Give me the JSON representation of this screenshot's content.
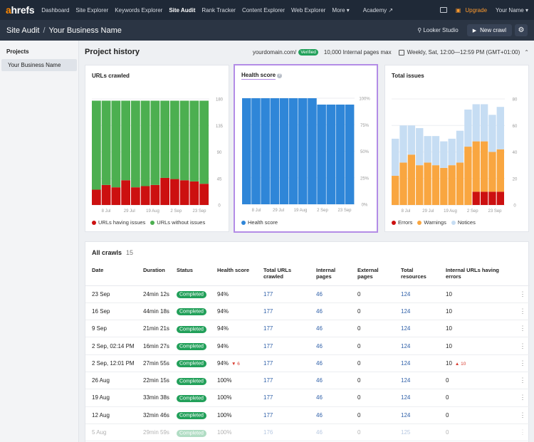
{
  "nav": {
    "logo_a": "a",
    "logo_rest": "hrefs",
    "items": [
      "Dashboard",
      "Site Explorer",
      "Keywords Explorer",
      "Site Audit",
      "Rank Tracker",
      "Content Explorer",
      "Web Explorer",
      "More ▾",
      "Academy ↗"
    ],
    "upgrade": "Upgrade",
    "user": "Your Name ▾"
  },
  "subhead": {
    "section": "Site Audit",
    "project": "Your Business Name",
    "looker": "Looker Studio",
    "new_crawl": "New crawl"
  },
  "sidebar": {
    "title": "Projects",
    "items": [
      "Your Business Name"
    ]
  },
  "project_history": {
    "title": "Project history",
    "domain": "yourdomain.com/",
    "verified": "Verified",
    "limit": "10,000 Internal pages max",
    "schedule": "Weekly, Sat, 12:00—12:59 PM (GMT+01:00)"
  },
  "colors": {
    "green": "#4caf50",
    "red": "#cc1010",
    "blue": "#2f86d8",
    "orange": "#f9a640",
    "light_blue": "#c6ddf3",
    "purple_highlight": "#b38ce6"
  },
  "chart_data": [
    {
      "type": "bar",
      "title": "URLs crawled",
      "x_ticks": [
        "8 Jul",
        "29 Jul",
        "19 Aug",
        "2 Sep",
        "23 Sep"
      ],
      "y_ticks": [
        "180",
        "135",
        "90",
        "45",
        "0"
      ],
      "ylim": [
        0,
        180
      ],
      "series": [
        {
          "name": "URLs having issues",
          "values": [
            26,
            34,
            30,
            42,
            30,
            32,
            34,
            46,
            44,
            42,
            40,
            36
          ]
        },
        {
          "name": "URLs without issues",
          "values": [
            151,
            143,
            147,
            135,
            147,
            145,
            143,
            131,
            133,
            135,
            137,
            141
          ]
        }
      ],
      "legend": [
        "URLs having issues",
        "URLs without issues"
      ]
    },
    {
      "type": "bar",
      "title": "Health score",
      "x_ticks": [
        "8 Jul",
        "29 Jul",
        "19 Aug",
        "2 Sep",
        "23 Sep"
      ],
      "y_ticks": [
        "100%",
        "75%",
        "50%",
        "25%",
        "0%"
      ],
      "ylim": [
        0,
        100
      ],
      "series": [
        {
          "name": "Health score",
          "values": [
            100,
            100,
            100,
            100,
            100,
            100,
            100,
            100,
            94,
            94,
            94,
            94
          ]
        }
      ],
      "legend": [
        "Health score"
      ]
    },
    {
      "type": "bar",
      "title": "Total issues",
      "x_ticks": [
        "8 Jul",
        "29 Jul",
        "19 Aug",
        "2 Sep",
        "23 Sep"
      ],
      "y_ticks": [
        "80",
        "60",
        "40",
        "20",
        "0"
      ],
      "ylim": [
        0,
        80
      ],
      "series": [
        {
          "name": "Errors",
          "values": [
            0,
            0,
            0,
            0,
            0,
            0,
            0,
            0,
            0,
            0,
            10,
            10,
            10,
            10
          ]
        },
        {
          "name": "Warnings",
          "values": [
            22,
            32,
            38,
            30,
            32,
            30,
            28,
            30,
            32,
            44,
            38,
            38,
            30,
            32
          ]
        },
        {
          "name": "Notices",
          "values": [
            28,
            28,
            22,
            28,
            20,
            22,
            20,
            20,
            24,
            28,
            28,
            28,
            28,
            32
          ]
        }
      ],
      "legend": [
        "Errors",
        "Warnings",
        "Notices"
      ]
    }
  ],
  "crawls": {
    "title": "All crawls",
    "count": "15",
    "headers": [
      "Date",
      "Duration",
      "Status",
      "Health score",
      "Total URLs crawled",
      "Internal pages",
      "External pages",
      "Total resources",
      "Internal URLs having errors"
    ],
    "rows": [
      {
        "date": "23 Sep",
        "duration": "24min 12s",
        "status": "Completed",
        "health": "94%",
        "health_delta": "",
        "total": "177",
        "internal": "46",
        "external": "0",
        "resources": "124",
        "errors": "10",
        "errors_delta": ""
      },
      {
        "date": "16 Sep",
        "duration": "44min 18s",
        "status": "Completed",
        "health": "94%",
        "health_delta": "",
        "total": "177",
        "internal": "46",
        "external": "0",
        "resources": "124",
        "errors": "10",
        "errors_delta": ""
      },
      {
        "date": "9 Sep",
        "duration": "21min 21s",
        "status": "Completed",
        "health": "94%",
        "health_delta": "",
        "total": "177",
        "internal": "46",
        "external": "0",
        "resources": "124",
        "errors": "10",
        "errors_delta": ""
      },
      {
        "date": "2 Sep, 02:14 PM",
        "duration": "16min 27s",
        "status": "Completed",
        "health": "94%",
        "health_delta": "",
        "total": "177",
        "internal": "46",
        "external": "0",
        "resources": "124",
        "errors": "10",
        "errors_delta": ""
      },
      {
        "date": "2 Sep, 12:01 PM",
        "duration": "27min 55s",
        "status": "Completed",
        "health": "94%",
        "health_delta": "▼ 6",
        "total": "177",
        "internal": "46",
        "external": "0",
        "resources": "124",
        "errors": "10",
        "errors_delta": "▲ 10"
      },
      {
        "date": "26 Aug",
        "duration": "22min 15s",
        "status": "Completed",
        "health": "100%",
        "health_delta": "",
        "total": "177",
        "internal": "46",
        "external": "0",
        "resources": "124",
        "errors": "0",
        "errors_delta": ""
      },
      {
        "date": "19 Aug",
        "duration": "33min 38s",
        "status": "Completed",
        "health": "100%",
        "health_delta": "",
        "total": "177",
        "internal": "46",
        "external": "0",
        "resources": "124",
        "errors": "0",
        "errors_delta": ""
      },
      {
        "date": "12 Aug",
        "duration": "32min 46s",
        "status": "Completed",
        "health": "100%",
        "health_delta": "",
        "total": "177",
        "internal": "46",
        "external": "0",
        "resources": "124",
        "errors": "0",
        "errors_delta": ""
      },
      {
        "date": "5 Aug",
        "duration": "29min 59s",
        "status": "Completed",
        "health": "100%",
        "health_delta": "",
        "total": "176",
        "internal": "46",
        "external": "0",
        "resources": "125",
        "errors": "0",
        "errors_delta": ""
      }
    ]
  }
}
